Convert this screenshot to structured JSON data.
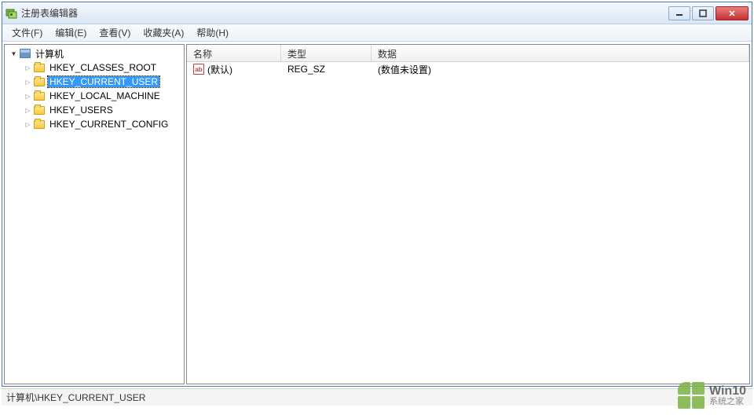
{
  "window": {
    "title": "注册表编辑器"
  },
  "menu": {
    "file": "文件(F)",
    "edit": "编辑(E)",
    "view": "查看(V)",
    "favorites": "收藏夹(A)",
    "help": "帮助(H)"
  },
  "tree": {
    "root": "计算机",
    "hives": [
      "HKEY_CLASSES_ROOT",
      "HKEY_CURRENT_USER",
      "HKEY_LOCAL_MACHINE",
      "HKEY_USERS",
      "HKEY_CURRENT_CONFIG"
    ],
    "selected_index": 1
  },
  "list": {
    "columns": {
      "name": "名称",
      "type": "类型",
      "data": "数据"
    },
    "rows": [
      {
        "name": "(默认)",
        "type": "REG_SZ",
        "data": "(数值未设置)"
      }
    ]
  },
  "statusbar": "计算机\\HKEY_CURRENT_USER",
  "watermark": {
    "top": "Win10",
    "bottom": "系统之家"
  }
}
